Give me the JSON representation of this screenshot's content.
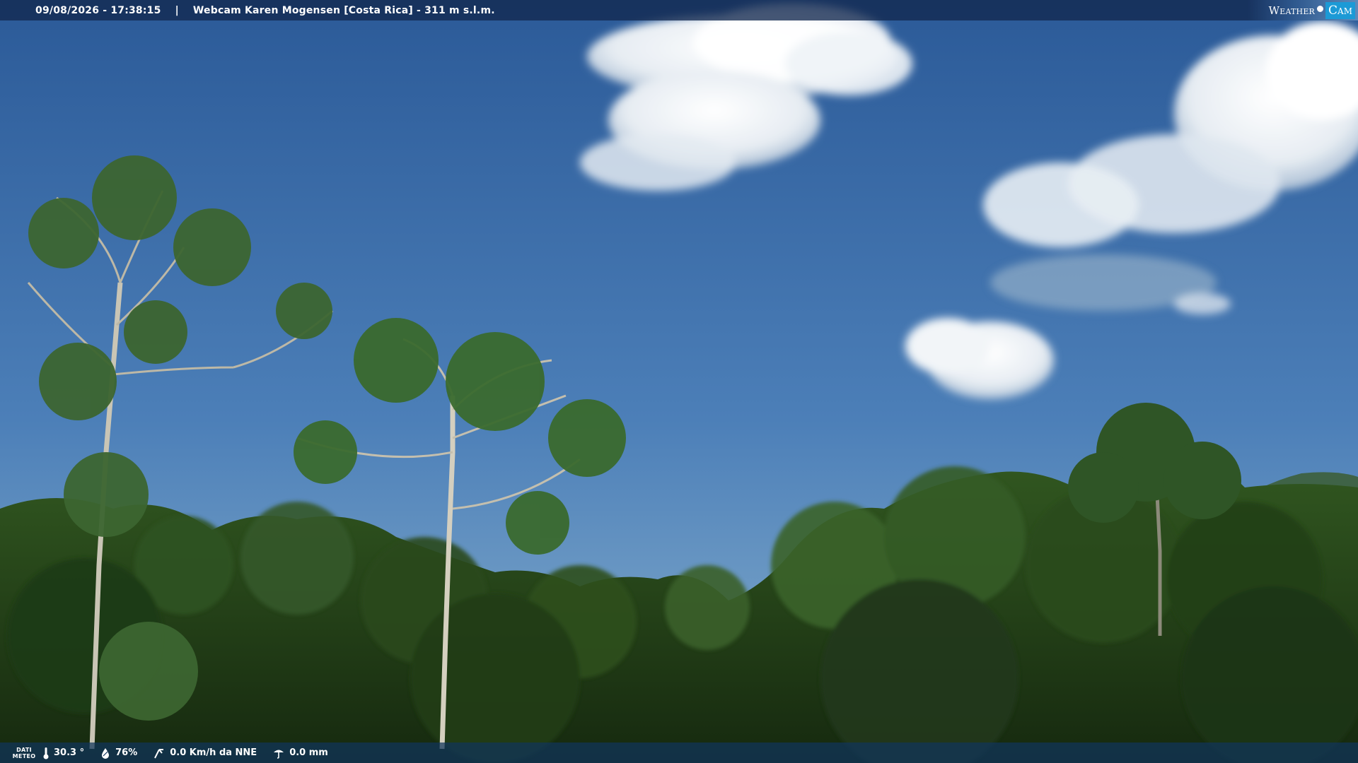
{
  "header": {
    "datetime": "09/08/2026 - 17:38:15",
    "separator": "|",
    "title": "Webcam Karen Mogensen [Costa Rica] - 311 m s.l.m."
  },
  "brand": {
    "weather": "Weather",
    "cam": "Cam",
    "accent": "#1c9ad6"
  },
  "footer": {
    "label_line1": "DATI",
    "label_line2": "METEO",
    "temperature": "30.3 °",
    "humidity": "76%",
    "wind": "0.0 Km/h da NNE",
    "rain": "0.0 mm",
    "icons": [
      "thermometer-icon",
      "humidity-drop-icon",
      "wind-icon",
      "rain-gauge-icon"
    ]
  },
  "colors": {
    "sky_top": "#2f5f9e",
    "sky_bottom": "#7aa6c8",
    "foliage_dark": "#1f3a16",
    "foliage_mid": "#3b6a27"
  }
}
